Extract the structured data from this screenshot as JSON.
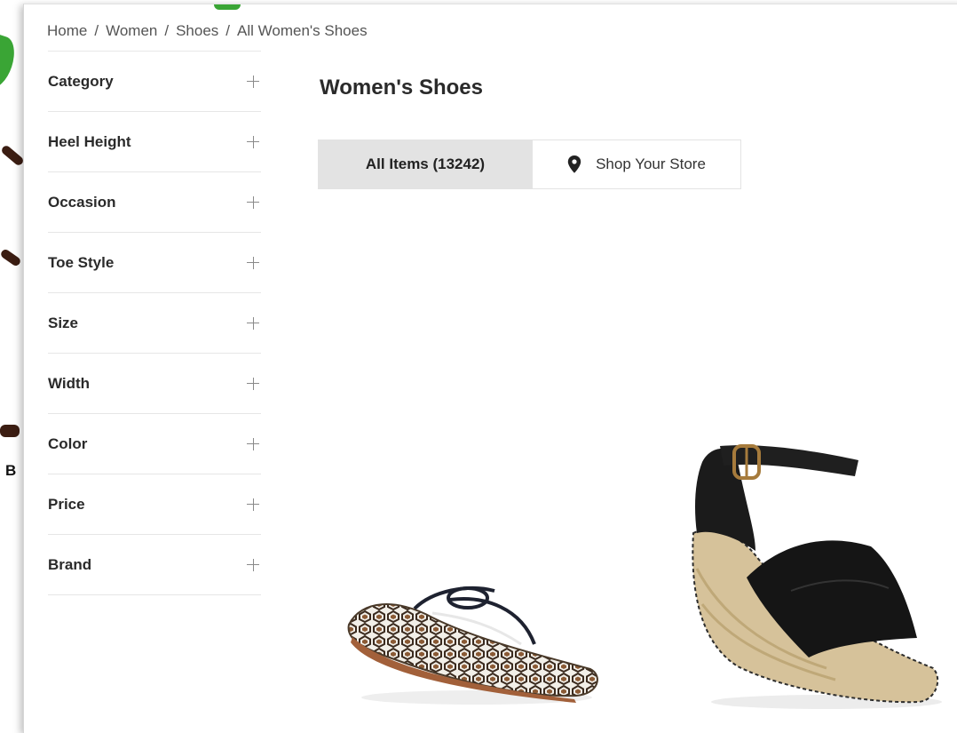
{
  "background": {
    "stray_letter": "B"
  },
  "breadcrumb": [
    {
      "label": "Home"
    },
    {
      "label": "Women"
    },
    {
      "label": "Shoes"
    },
    {
      "label": "All Women's Shoes"
    }
  ],
  "breadcrumb_separator": "/",
  "filters": [
    {
      "label": "Category"
    },
    {
      "label": "Heel Height"
    },
    {
      "label": "Occasion"
    },
    {
      "label": "Toe Style"
    },
    {
      "label": "Size"
    },
    {
      "label": "Width"
    },
    {
      "label": "Color"
    },
    {
      "label": "Price"
    },
    {
      "label": "Brand"
    }
  ],
  "page_title": "Women's Shoes",
  "tabs": {
    "all_items": "All Items (13242)",
    "shop_store": "Shop Your Store"
  },
  "icons": {
    "filter_expand": "plus-icon",
    "store": "location-pin-icon"
  },
  "colors": {
    "active_tab_bg": "#e3e3e3",
    "leaf_green": "#3aa535",
    "branch_brown": "#3b1d12"
  },
  "products": [
    {
      "image": "patterned-thong-sandal"
    },
    {
      "image": "black-espadrille-wedge-sandal"
    }
  ]
}
